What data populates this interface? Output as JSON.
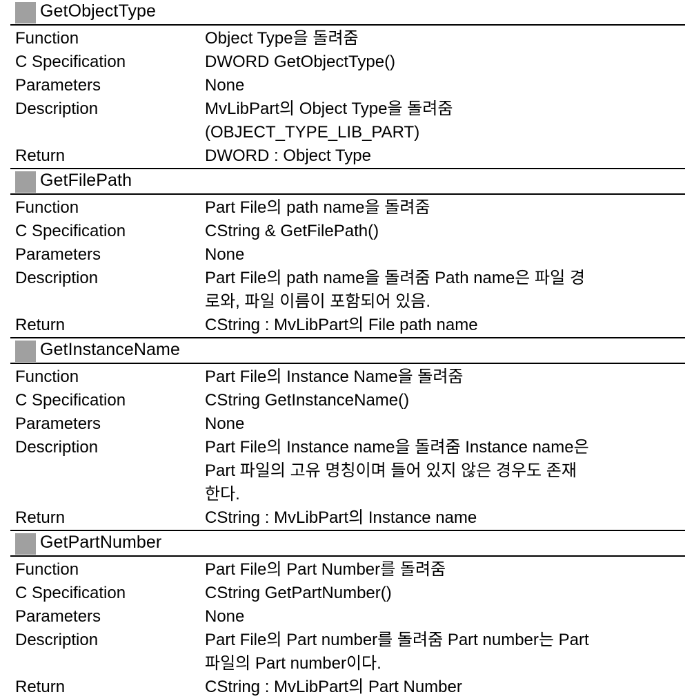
{
  "document": {
    "accent_gray": "#a0a0a0",
    "rule_color": "#000000",
    "background": "#ffffff",
    "sections": [
      {
        "title": "GetObjectType",
        "rows": [
          {
            "label": "Function",
            "lines": [
              "Object Type을 돌려줌"
            ]
          },
          {
            "label": "C Specification",
            "lines": [
              "DWORD GetObjectType()"
            ]
          },
          {
            "label": "Parameters",
            "lines": [
              "None"
            ]
          },
          {
            "label": "Description",
            "lines": [
              "MvLibPart의 Object Type을 돌려줌",
              "(OBJECT_TYPE_LIB_PART)"
            ]
          },
          {
            "label": "Return",
            "lines": [
              "DWORD : Object Type"
            ]
          }
        ]
      },
      {
        "title": "GetFilePath",
        "rows": [
          {
            "label": "Function",
            "lines": [
              "Part File의 path name을 돌려줌"
            ]
          },
          {
            "label": "C Specification",
            "lines": [
              "CString & GetFilePath()"
            ]
          },
          {
            "label": "Parameters",
            "lines": [
              "None"
            ]
          },
          {
            "label": "Description",
            "lines": [
              "Part File의 path name을 돌려줌 Path name은 파일 경",
              "로와, 파일 이름이 포함되어 있음."
            ]
          },
          {
            "label": "Return",
            "lines": [
              "CString : MvLibPart의 File path name"
            ]
          }
        ]
      },
      {
        "title": "GetInstanceName",
        "rows": [
          {
            "label": "Function",
            "lines": [
              "Part File의 Instance Name을 돌려줌"
            ]
          },
          {
            "label": "C Specification",
            "lines": [
              "CString GetInstanceName()"
            ]
          },
          {
            "label": "Parameters",
            "lines": [
              "None"
            ]
          },
          {
            "label": "Description",
            "lines": [
              "Part File의 Instance name을 돌려줌 Instance name은",
              "Part 파일의 고유 명칭이며 들어 있지 않은 경우도 존재",
              "한다."
            ]
          },
          {
            "label": "Return",
            "lines": [
              "CString : MvLibPart의 Instance name"
            ]
          }
        ]
      },
      {
        "title": "GetPartNumber",
        "rows": [
          {
            "label": "Function",
            "lines": [
              "Part File의 Part Number를 돌려줌"
            ]
          },
          {
            "label": "C Specification",
            "lines": [
              "CString GetPartNumber()"
            ]
          },
          {
            "label": "Parameters",
            "lines": [
              "None"
            ]
          },
          {
            "label": "Description",
            "lines": [
              "Part File의 Part number를 돌려줌 Part number는 Part",
              "파일의 Part number이다."
            ]
          },
          {
            "label": "Return",
            "lines": [
              "CString : MvLibPart의 Part Number"
            ]
          }
        ]
      }
    ]
  }
}
